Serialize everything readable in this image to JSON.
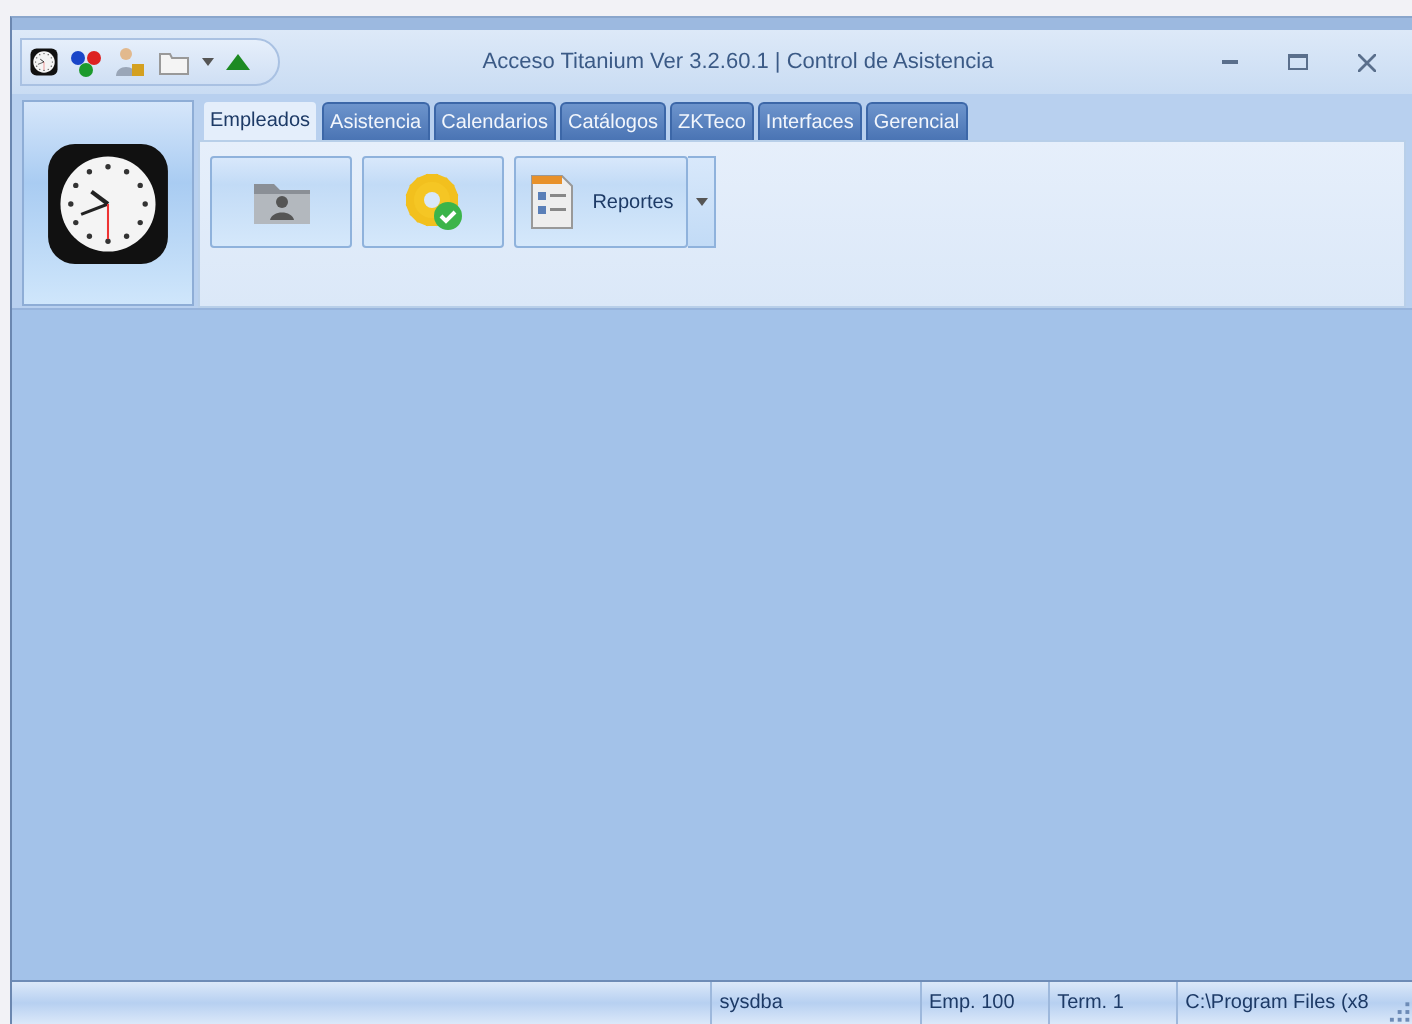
{
  "window": {
    "title": "Acceso Titanium  Ver 3.2.60.1 | Control de Asistencia"
  },
  "tabs": [
    {
      "label": "Empleados",
      "selected": true
    },
    {
      "label": "Asistencia",
      "selected": false
    },
    {
      "label": "Calendarios",
      "selected": false
    },
    {
      "label": "Catálogos",
      "selected": false
    },
    {
      "label": "ZKTeco",
      "selected": false
    },
    {
      "label": "Interfaces",
      "selected": false
    },
    {
      "label": "Gerencial",
      "selected": false
    }
  ],
  "ribbon_buttons": [
    {
      "kind": "folder"
    },
    {
      "kind": "gear"
    },
    {
      "kind": "report",
      "label": "Reportes"
    }
  ],
  "status_bar": [
    "sysdba",
    "Emp. 100",
    "Term. 1",
    "C:\\Program Files (x8"
  ]
}
